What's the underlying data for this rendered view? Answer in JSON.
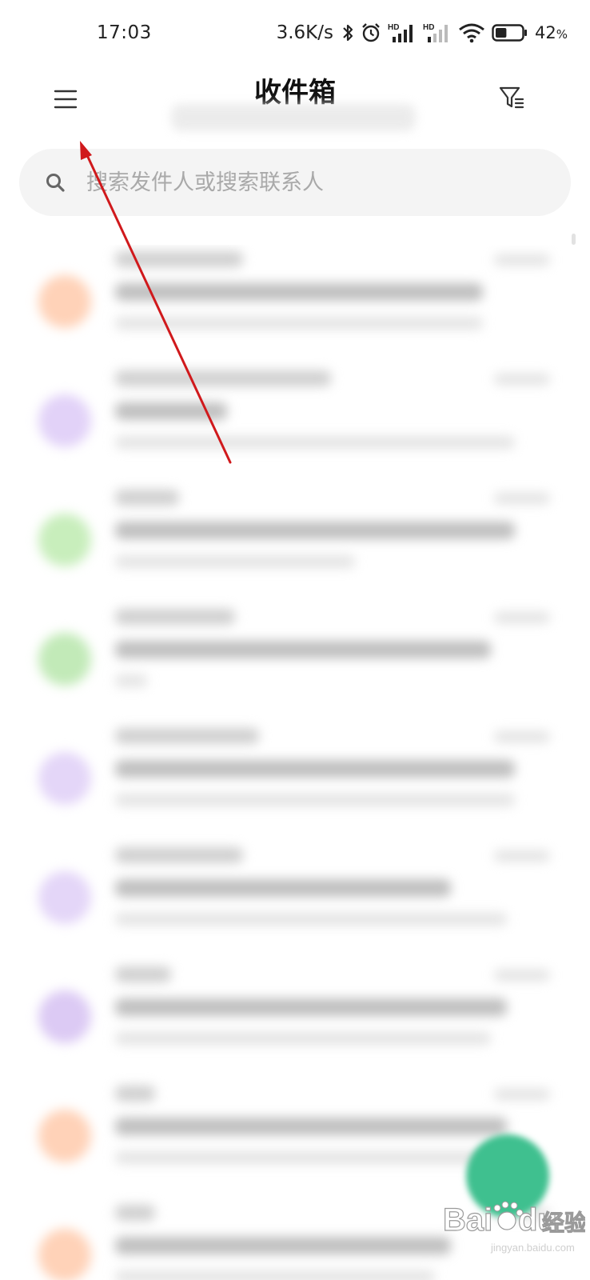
{
  "status_bar": {
    "time": "17:03",
    "net_speed": "3.6K/s",
    "battery_percent": "42",
    "battery_unit": "%",
    "battery_level": 0.42,
    "icons": [
      "bluetooth-icon",
      "alarm-icon",
      "hd-signal-icon",
      "hd-signal-icon",
      "wifi-icon",
      "battery-icon"
    ]
  },
  "header": {
    "title": "收件箱",
    "menu_icon": "hamburger-menu-icon",
    "filter_icon": "filter-icon"
  },
  "search": {
    "placeholder": "搜索发件人或搜索联系人",
    "icon": "search-icon"
  },
  "mail_list": {
    "avatar_colors": [
      "#ffd2b8",
      "#e2d2f8",
      "#c8eebc",
      "#c2eab8",
      "#e4d6f8",
      "#e4d6f8",
      "#dccaf4",
      "#ffd2b8",
      "#ffd2b8"
    ]
  },
  "fab": {
    "color": "#3fc08f"
  },
  "annotation": {
    "arrow_color": "#d0191c"
  },
  "watermark": {
    "brand": "Bai",
    "brand_tail": "du",
    "cn": "经验",
    "url": "jingyan.baidu.com"
  }
}
